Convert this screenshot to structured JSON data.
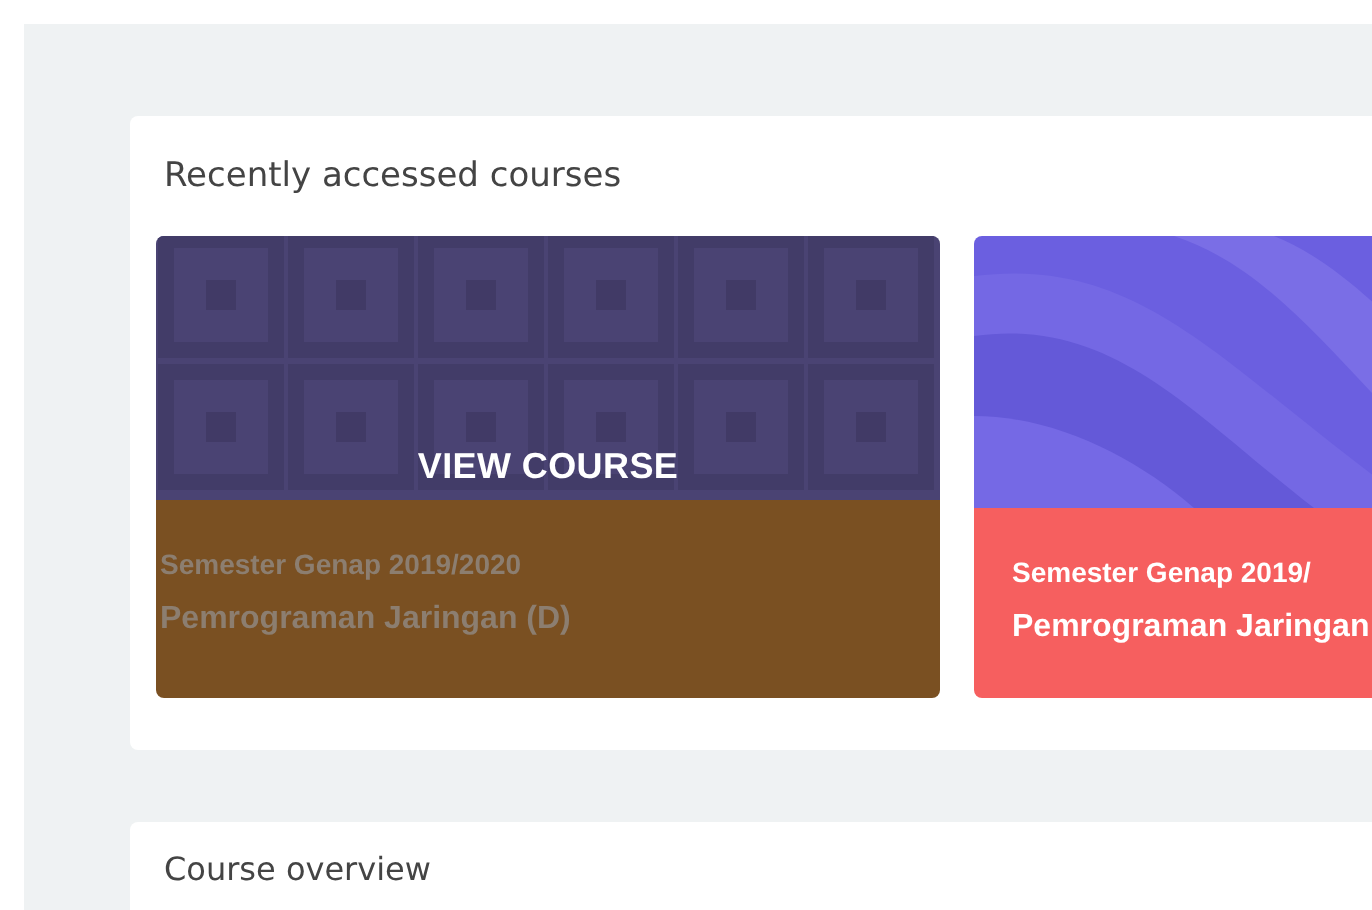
{
  "recent_courses": {
    "title": "Recently accessed courses",
    "courses": [
      {
        "hovered": true,
        "action": "VIEW COURSE",
        "color": "#7a5022",
        "term": "Semester Genap 2019/2020",
        "name": "Pemrograman Jaringan (D)"
      },
      {
        "hovered": false,
        "color": "#f65f5f",
        "term": "Semester Genap 2019/",
        "name": "Pemrograman Jaringan"
      }
    ]
  },
  "course_overview": {
    "title": "Course overview"
  }
}
